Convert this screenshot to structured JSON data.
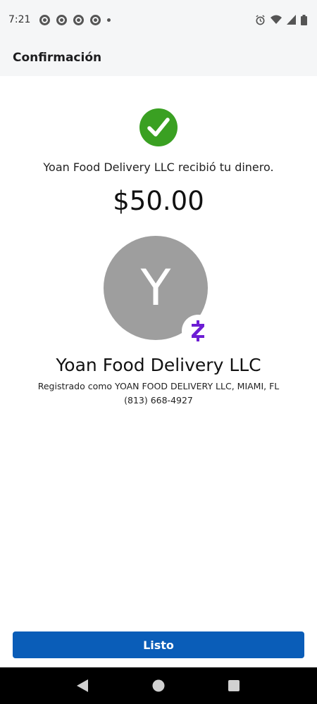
{
  "status_bar": {
    "time": "7:21",
    "notification_icons": [
      "chrome-icon",
      "chrome-icon",
      "chrome-icon",
      "chrome-icon"
    ],
    "right_icons": [
      "alarm-icon",
      "wifi-icon",
      "signal-icon",
      "battery-icon"
    ]
  },
  "header": {
    "title": "Confirmación"
  },
  "confirmation": {
    "status_icon": "check-circle-icon",
    "message": "Yoan Food Delivery LLC recibió tu dinero.",
    "amount": "$50.00"
  },
  "recipient": {
    "avatar_letter": "Y",
    "badge_icon": "zelle-icon",
    "name": "Yoan Food Delivery LLC",
    "registered_as": "Registrado como YOAN FOOD DELIVERY LLC, MIAMI, FL",
    "phone": "(813) 668-4927"
  },
  "actions": {
    "done_label": "Listo"
  },
  "colors": {
    "accent": "#0a5db8",
    "success": "#3aa022",
    "zelle": "#6d1ed4",
    "avatar_bg": "#9e9e9e"
  },
  "nav_bar": {
    "icons": [
      "back-icon",
      "home-icon",
      "recents-icon"
    ]
  }
}
